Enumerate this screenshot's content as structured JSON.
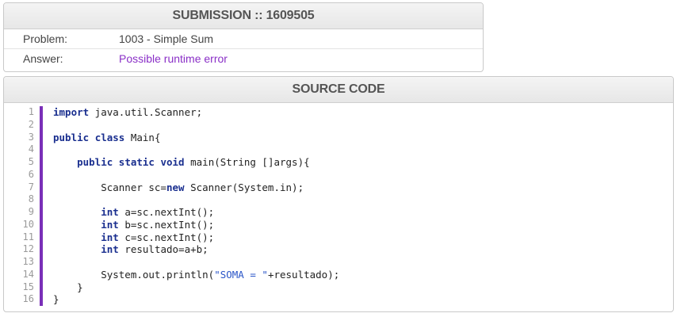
{
  "submission": {
    "title": "SUBMISSION :: 1609505",
    "problem_label": "Problem:",
    "problem_value": "1003 - Simple Sum",
    "answer_label": "Answer:",
    "answer_value": "Possible runtime error",
    "answer_color": "#8a2fc7"
  },
  "source": {
    "title": "SOURCE CODE",
    "accent_color": "#7a2fb8",
    "line_numbers": [
      "1",
      "2",
      "3",
      "4",
      "5",
      "6",
      "7",
      "8",
      "9",
      "10",
      "11",
      "12",
      "13",
      "14",
      "15",
      "16"
    ],
    "lines": [
      [
        {
          "t": "import",
          "k": "kw"
        },
        {
          "t": " java.util.Scanner;"
        }
      ],
      [],
      [
        {
          "t": "public",
          "k": "kw"
        },
        {
          "t": " "
        },
        {
          "t": "class",
          "k": "kw"
        },
        {
          "t": " Main{"
        }
      ],
      [],
      [
        {
          "t": "    "
        },
        {
          "t": "public",
          "k": "kw"
        },
        {
          "t": " "
        },
        {
          "t": "static",
          "k": "kw"
        },
        {
          "t": " "
        },
        {
          "t": "void",
          "k": "kw"
        },
        {
          "t": " main(String []args){"
        }
      ],
      [],
      [
        {
          "t": "        Scanner sc="
        },
        {
          "t": "new",
          "k": "kw"
        },
        {
          "t": " Scanner(System.in);"
        }
      ],
      [],
      [
        {
          "t": "        "
        },
        {
          "t": "int",
          "k": "kw"
        },
        {
          "t": " a=sc.nextInt();"
        }
      ],
      [
        {
          "t": "        "
        },
        {
          "t": "int",
          "k": "kw"
        },
        {
          "t": " b=sc.nextInt();"
        }
      ],
      [
        {
          "t": "        "
        },
        {
          "t": "int",
          "k": "kw"
        },
        {
          "t": " c=sc.nextInt();"
        }
      ],
      [
        {
          "t": "        "
        },
        {
          "t": "int",
          "k": "kw"
        },
        {
          "t": " resultado=a+b;"
        }
      ],
      [],
      [
        {
          "t": "        System.out.println("
        },
        {
          "t": "\"SOMA = \"",
          "k": "str"
        },
        {
          "t": "+resultado);"
        }
      ],
      [
        {
          "t": "    }"
        }
      ],
      [
        {
          "t": "}"
        }
      ]
    ]
  }
}
